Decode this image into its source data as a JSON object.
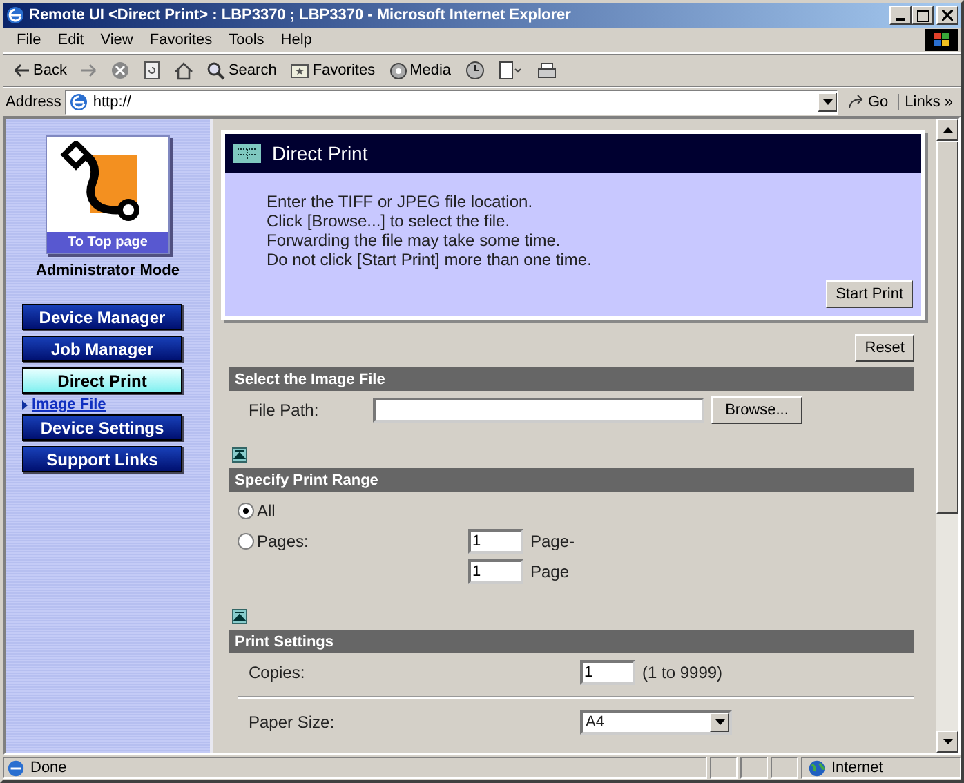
{
  "window": {
    "title": "Remote UI <Direct Print> : LBP3370 ; LBP3370 - Microsoft Internet Explorer"
  },
  "menu": [
    "File",
    "Edit",
    "View",
    "Favorites",
    "Tools",
    "Help"
  ],
  "toolbar": [
    {
      "kind": "back",
      "label": "Back"
    },
    {
      "kind": "forward"
    },
    {
      "kind": "stop"
    },
    {
      "kind": "refresh"
    },
    {
      "kind": "home"
    },
    {
      "kind": "search",
      "label": "Search"
    },
    {
      "kind": "favorites",
      "label": "Favorites"
    },
    {
      "kind": "media",
      "label": "Media"
    },
    {
      "kind": "history"
    },
    {
      "kind": "edit"
    },
    {
      "kind": "print"
    }
  ],
  "address": {
    "label": "Address",
    "value": "http://",
    "go": "Go",
    "links": "Links",
    "more": "»"
  },
  "sidebar": {
    "top_link": "To Top page",
    "mode": "Administrator Mode",
    "items": [
      {
        "label": "Device Manager",
        "selected": false
      },
      {
        "label": "Job Manager",
        "selected": false
      },
      {
        "label": "Direct Print",
        "selected": true,
        "children": [
          {
            "label": "Image File"
          }
        ]
      },
      {
        "label": "Device Settings",
        "selected": false
      },
      {
        "label": "Support Links",
        "selected": false
      }
    ]
  },
  "panel": {
    "title": "Direct Print",
    "lines": [
      "Enter the TIFF or JPEG file location.",
      "Click [Browse...] to select the file.",
      "Forwarding the file may take some time.",
      "Do not click [Start Print] more than one time."
    ],
    "button": "Start Print"
  },
  "reset": "Reset",
  "sections": [
    {
      "title": "Select the Image File",
      "rows": [
        {
          "kind": "file",
          "label": "File Path:",
          "button": "Browse..."
        }
      ]
    },
    {
      "title": "Specify Print Range",
      "rows": [
        {
          "kind": "radio",
          "label": "All",
          "selected": true
        },
        {
          "kind": "radio",
          "label": "Pages:",
          "selected": false,
          "value": "1",
          "suffix": "Page-"
        },
        {
          "kind": "number",
          "value": "1",
          "suffix": "Page"
        }
      ]
    },
    {
      "title": "Print Settings",
      "rows": [
        {
          "kind": "number",
          "label": "Copies:",
          "value": "1",
          "suffix": "(1 to 9999)"
        },
        {
          "kind": "divider"
        },
        {
          "kind": "select",
          "label": "Paper Size:",
          "value": "A4"
        }
      ]
    }
  ],
  "status": {
    "text": "Done",
    "zone": "Internet"
  }
}
